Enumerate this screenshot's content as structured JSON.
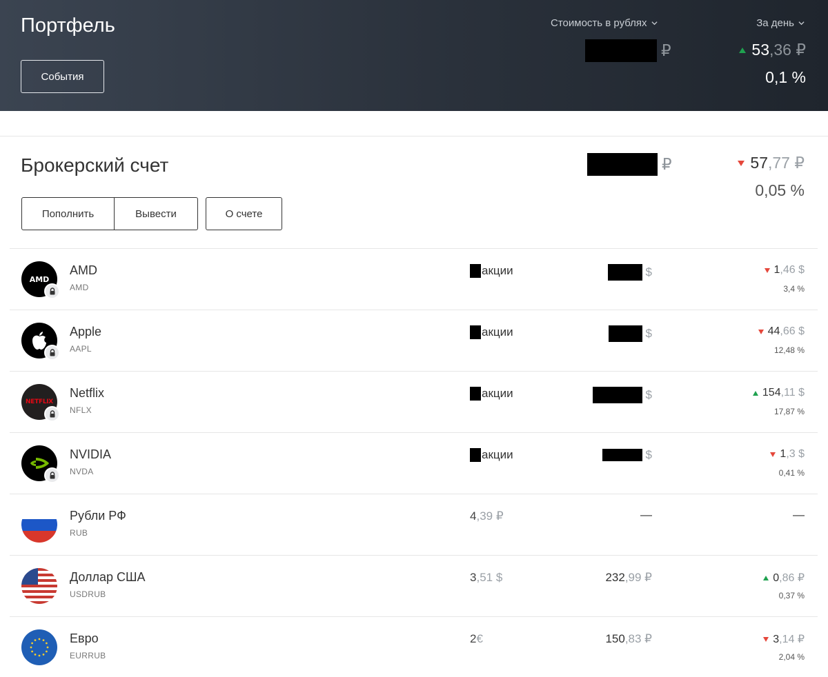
{
  "header": {
    "title": "Портфель",
    "events_label": "События",
    "value_dropdown": "Стоимость в рублях",
    "period_dropdown": "За день",
    "value_currency": "₽",
    "change_int": "53",
    "change_dec": ",36 ₽",
    "change_direction": "up",
    "change_pct": "0,1 %"
  },
  "account": {
    "title": "Брокерский счет",
    "value_currency": "₽",
    "change_int": "57",
    "change_dec": ",77 ₽",
    "change_direction": "down",
    "change_pct": "0,05 %",
    "buttons": {
      "deposit": "Пополнить",
      "withdraw": "Вывести",
      "about": "О счете"
    }
  },
  "holdings": [
    {
      "name": "AMD",
      "ticker": "AMD",
      "qty_text": "акции",
      "value_currency": "$",
      "change_int": "1",
      "change_dec": ",46 $",
      "direction": "down",
      "pct": "3,4 %"
    },
    {
      "name": "Apple",
      "ticker": "AAPL",
      "qty_text": "акции",
      "value_currency": "$",
      "change_int": "44",
      "change_dec": ",66 $",
      "direction": "down",
      "pct": "12,48 %"
    },
    {
      "name": "Netflix",
      "ticker": "NFLX",
      "qty_text": "акции",
      "value_currency": "$",
      "change_int": "154",
      "change_dec": ",11 $",
      "direction": "up",
      "pct": "17,87 %"
    },
    {
      "name": "NVIDIA",
      "ticker": "NVDA",
      "qty_text": "акции",
      "value_currency": "$",
      "change_int": "1",
      "change_dec": ",3 $",
      "direction": "down",
      "pct": "0,41 %"
    },
    {
      "name": "Рубли РФ",
      "ticker": "RUB",
      "qty_int": "4",
      "qty_dec": ",39 ₽",
      "value_dash": "—",
      "change_dash": "—"
    },
    {
      "name": "Доллар США",
      "ticker": "USDRUB",
      "qty_int": "3",
      "qty_dec": ",51 $",
      "value_int": "232",
      "value_dec": ",99 ₽",
      "change_int": "0",
      "change_dec": ",86 ₽",
      "direction": "up",
      "pct": "0,37 %"
    },
    {
      "name": "Евро",
      "ticker": "EURRUB",
      "qty_int": "2",
      "qty_dec": " €",
      "value_int": "150",
      "value_dec": ",83 ₽",
      "change_int": "3",
      "change_dec": ",14 ₽",
      "direction": "down",
      "pct": "2,04 %"
    }
  ],
  "logos": {
    "amd": "AMD",
    "netflix": "NETFLIX"
  },
  "colors": {
    "up": "#1fa14f",
    "down": "#e5473b",
    "header_bg": "#2a313b"
  }
}
